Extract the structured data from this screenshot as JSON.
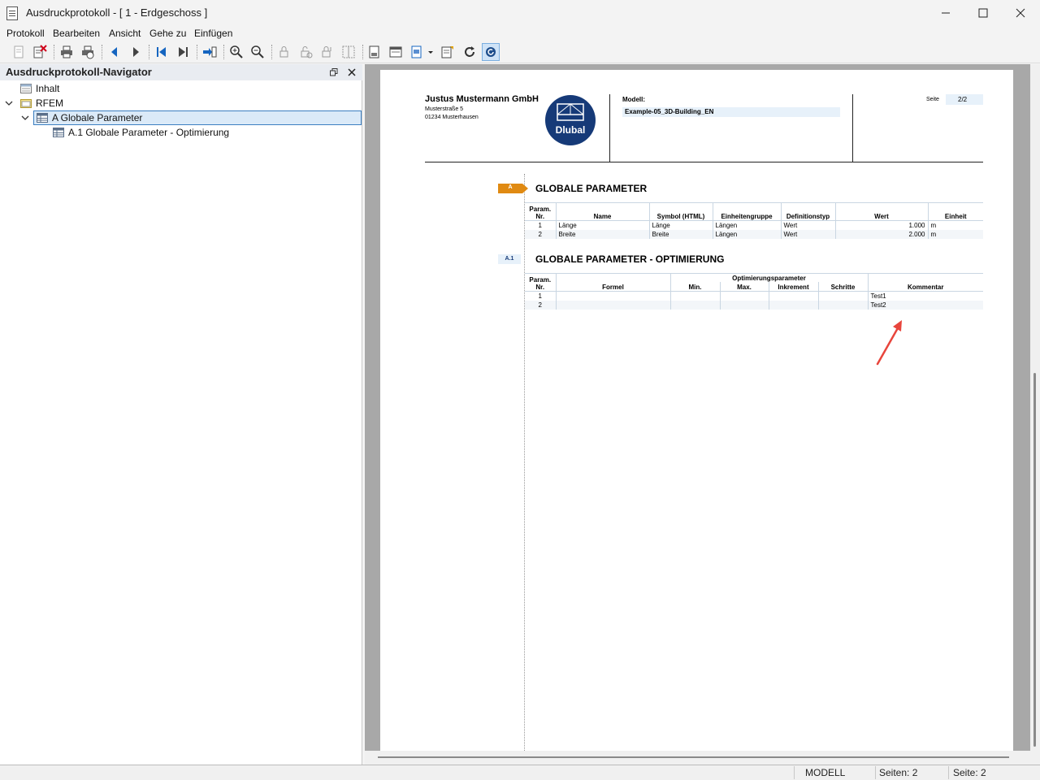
{
  "window": {
    "title": "Ausdruckprotokoll - [ 1 - Erdgeschoss ]"
  },
  "menu": [
    "Protokoll",
    "Bearbeiten",
    "Ansicht",
    "Gehe zu",
    "Einfügen"
  ],
  "navigator": {
    "title": "Ausdruckprotokoll-Navigator",
    "items": {
      "inhalt": "Inhalt",
      "rfem": "RFEM",
      "globale": "A Globale Parameter",
      "optimierung": "A.1 Globale Parameter - Optimierung"
    }
  },
  "page": {
    "company": {
      "name": "Justus Mustermann GmbH",
      "street": "Musterstraße 5",
      "city": "01234 Musterhausen"
    },
    "logo_text": "Dlubal",
    "model_label": "Modell:",
    "model_value": "Example-05_3D-Building_EN",
    "page_label": "Seite",
    "page_value": "2/2",
    "section_a": {
      "badge": "A",
      "title": "GLOBALE PARAMETER",
      "headers": [
        "Param.",
        "Nr.",
        "Name",
        "Symbol (HTML)",
        "Einheitengruppe",
        "Definitionstyp",
        "Wert",
        "Einheit"
      ],
      "rows": [
        {
          "nr": "1",
          "name": "Länge",
          "symbol": "Länge",
          "group": "Längen",
          "type": "Wert",
          "value": "1.000",
          "unit": "m"
        },
        {
          "nr": "2",
          "name": "Breite",
          "symbol": "Breite",
          "group": "Längen",
          "type": "Wert",
          "value": "2.000",
          "unit": "m"
        }
      ]
    },
    "section_a1": {
      "badge": "A.1",
      "title": "GLOBALE PARAMETER - OPTIMIERUNG",
      "headers": [
        "Param.",
        "Nr.",
        "Formel",
        "Optimierungsparameter",
        "Min.",
        "Max.",
        "Inkrement",
        "Schritte",
        "Kommentar"
      ],
      "rows": [
        {
          "nr": "1",
          "comment": "Test1"
        },
        {
          "nr": "2",
          "comment": "Test2"
        }
      ]
    }
  },
  "status": {
    "mode": "MODELL",
    "pages": "Seiten: 2",
    "page": "Seite: 2"
  },
  "colors": {
    "accent_orange": "#e08a12",
    "logo_blue": "#163a78",
    "arrow_red": "#e8453c"
  }
}
